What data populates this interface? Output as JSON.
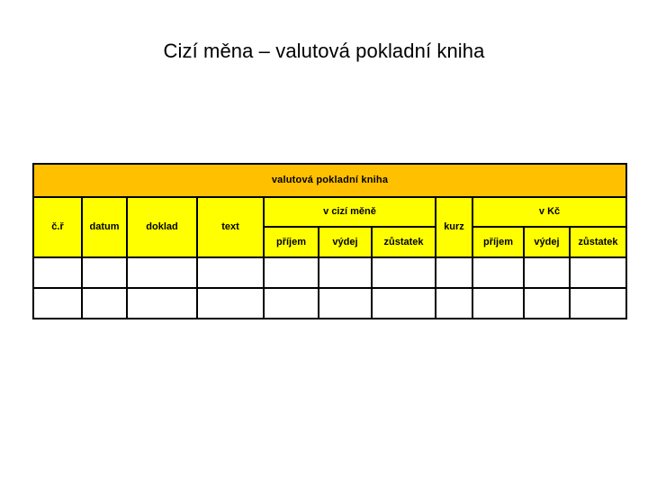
{
  "page": {
    "title": "Cizí měna – valutová pokladní kniha",
    "background_color": "#ffffff"
  },
  "colors": {
    "band": "#ffc000",
    "header": "#ffff00",
    "cell": "#ffffff",
    "border": "#000000",
    "text": "#000000"
  },
  "table": {
    "band_label": "valutová pokladní kniha",
    "columns": {
      "cislo_radku": "č.ř",
      "datum": "datum",
      "doklad": "doklad",
      "text": "text",
      "kurz": "kurz"
    },
    "groups": {
      "foreign_currency": "v cizí měně",
      "czk": "v Kč"
    },
    "subcolumns": {
      "foreign_currency": [
        "příjem",
        "výdej",
        "zůstatek"
      ],
      "czk": [
        "příjem",
        "výdej",
        "zůstatek"
      ]
    },
    "rows": [
      [
        "",
        "",
        "",
        "",
        "",
        "",
        "",
        "",
        "",
        "",
        ""
      ],
      [
        "",
        "",
        "",
        "",
        "",
        "",
        "",
        "",
        "",
        "",
        ""
      ]
    ]
  }
}
